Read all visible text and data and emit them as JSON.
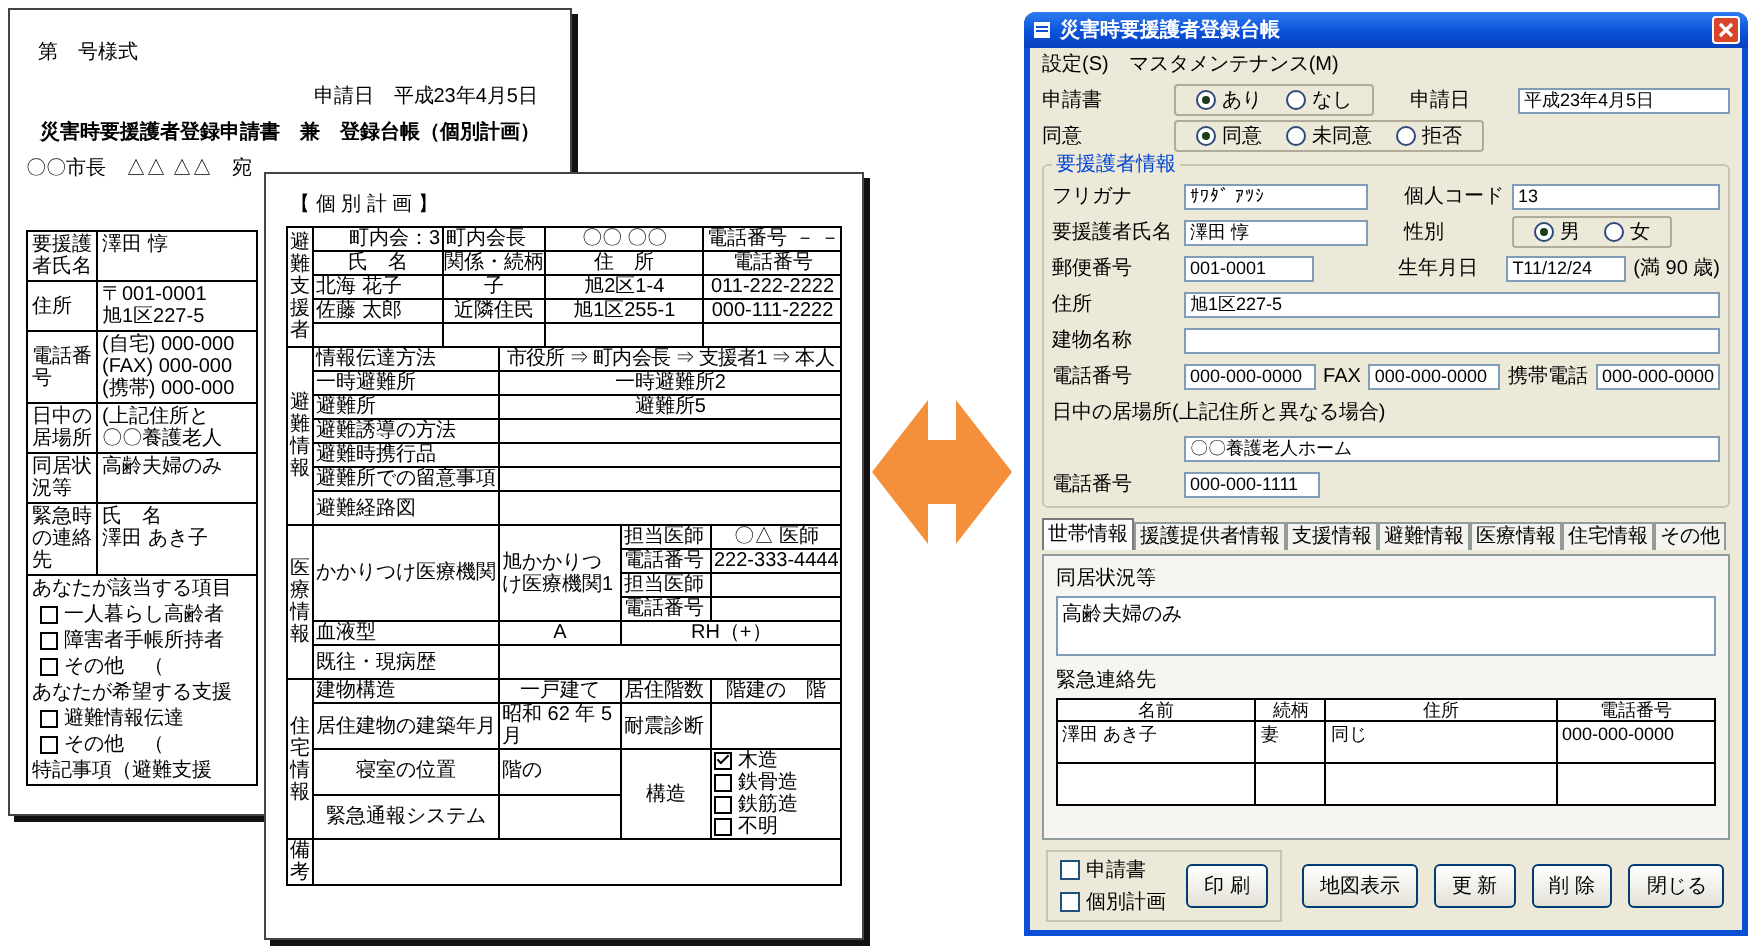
{
  "application_form": {
    "form_number": "第　号様式",
    "date": "申請日　平成23年4月5日",
    "title": "災害時要援護者登録申請書　兼　登録台帳（個別計画）",
    "addressee": "〇〇市長　△△ △△　宛",
    "rows": [
      {
        "label": "要援護者氏名",
        "lines": [
          "澤田 惇"
        ]
      },
      {
        "label": "住所",
        "lines": [
          "〒001-0001",
          "旭1区227-5"
        ]
      },
      {
        "label": "電話番号",
        "lines": [
          "(自宅) 000-000",
          "(FAX) 000-000",
          "(携帯) 000-000"
        ]
      },
      {
        "label": "日中の居場所",
        "lines": [
          "(上記住所と",
          "〇〇養護老人"
        ]
      },
      {
        "label": "同居状況等",
        "lines": [
          "高齢夫婦のみ"
        ]
      },
      {
        "label": "緊急時の連絡先",
        "lines": [
          "氏　名",
          "澤田 あき子"
        ]
      }
    ],
    "checklist": [
      {
        "kind": "note",
        "text": "あなたが該当する項目"
      },
      {
        "kind": "check",
        "text": "一人暮らし高齢者",
        "checked": false
      },
      {
        "kind": "check",
        "text": "障害者手帳所持者",
        "checked": false
      },
      {
        "kind": "check",
        "text": "その他　（",
        "checked": false
      },
      {
        "kind": "note",
        "text": "あなたが希望する支援"
      },
      {
        "kind": "check",
        "text": "避難情報伝達",
        "checked": false
      },
      {
        "kind": "check",
        "text": "その他　（",
        "checked": false
      },
      {
        "kind": "note",
        "text": "特記事項（避難支援"
      }
    ]
  },
  "individual_plan": {
    "heading": "【 個 別 計 画 】",
    "supporters": {
      "section": "避難支援者",
      "neighborhood": "町内会：3",
      "chief_label": "町内会長",
      "chief_name": "〇〇 〇〇",
      "phone_label": "電話番号",
      "phone_value": "－ －",
      "columns": [
        "氏　名",
        "関係・続柄",
        "住　所",
        "電話番号"
      ],
      "rows": [
        [
          "北海 花子",
          "子",
          "旭2区1-4",
          "011-222-2222"
        ],
        [
          "佐藤 太郎",
          "近隣住民",
          "旭1区255-1",
          "000-111-2222"
        ]
      ]
    },
    "evacuation": {
      "section": "避難情報",
      "rows": [
        {
          "label": "情報伝達方法",
          "value": "市役所 ⇒ 町内会長 ⇒ 支援者1 ⇒ 本人"
        },
        {
          "label": "一時避難所",
          "value": "一時避難所2"
        },
        {
          "label": "避難所",
          "value": "避難所5"
        },
        {
          "label": "避難誘導の方法"
        },
        {
          "label": "避難時携行品"
        },
        {
          "label": "避難所での留意事項"
        },
        {
          "label": "避難経路図"
        }
      ]
    },
    "medical": {
      "section": "医療情報",
      "clinic_label": "かかりつけ医療機関",
      "clinic": "旭かかりつけ医療機関1",
      "doctors": [
        {
          "label": "担当医師",
          "value": "〇△ 医師"
        },
        {
          "label": "電話番号",
          "value": "222-333-4444"
        },
        {
          "label": "担当医師"
        },
        {
          "label": "電話番号"
        }
      ],
      "blood_label": "血液型",
      "blood_abo": "A",
      "blood_rh": "RH（+）",
      "history_label": "既往・現病歴"
    },
    "housing": {
      "section": "住宅情報",
      "building_label": "建物構造",
      "building": "一戸建て",
      "floors_label": "居住階数",
      "floors": "階建の　階",
      "built_label": "居住建物の建築年月",
      "built": "昭和 62 年 5 月",
      "seismic_label": "耐震診断",
      "bedroom_label": "寝室の位置",
      "bedroom": "階の",
      "structure_label": "構造",
      "structures": [
        {
          "label": "木造",
          "checked": true
        },
        {
          "label": "鉄骨造",
          "checked": false
        },
        {
          "label": "鉄筋造",
          "checked": false
        },
        {
          "label": "不明",
          "checked": false
        }
      ],
      "alarm_label": "緊急通報システム"
    },
    "remarks": {
      "section": "備考"
    }
  },
  "app_window": {
    "title": "災害時要援護者登録台帳",
    "menu": [
      "設定(S)",
      "マスタメンテナンス(M)"
    ],
    "application": {
      "label": "申請書",
      "options": [
        {
          "label": "あり",
          "selected": true
        },
        {
          "label": "なし",
          "selected": false
        }
      ],
      "date_label": "申請日",
      "date_value": "平成23年4月5日"
    },
    "consent": {
      "label": "同意",
      "options": [
        {
          "label": "同意",
          "selected": true
        },
        {
          "label": "未同意",
          "selected": false
        },
        {
          "label": "拒否",
          "selected": false
        }
      ]
    },
    "person": {
      "legend": "要援護者情報",
      "furigana_label": "フリガナ",
      "furigana": "ｻﾜﾀﾞ ｱﾂｼ",
      "code_label": "個人コード",
      "code": "13",
      "name_label": "要援護者氏名",
      "name": "澤田 惇",
      "sex_label": "性別",
      "sex_options": [
        {
          "label": "男",
          "selected": true
        },
        {
          "label": "女",
          "selected": false
        }
      ],
      "postal_label": "郵便番号",
      "postal": "001-0001",
      "birth_label": "生年月日",
      "birth": "T11/12/24",
      "age": "(満 90 歳)",
      "address_label": "住所",
      "address": "旭1区227-5",
      "building_label": "建物名称",
      "phone_label": "電話番号",
      "phone": "000-000-0000",
      "fax_label": "FAX",
      "fax": "000-000-0000",
      "mobile_label": "携帯電話",
      "mobile": "000-000-0000",
      "daytime_label": "日中の居場所(上記住所と異なる場合)",
      "daytime": "〇〇養護老人ホーム",
      "daytime_phone_label": "電話番号",
      "daytime_phone": "000-000-1111"
    },
    "tabs": [
      {
        "label": "世帯情報",
        "selected": true
      },
      {
        "label": "援護提供者情報",
        "selected": false
      },
      {
        "label": "支援情報",
        "selected": false
      },
      {
        "label": "避難情報",
        "selected": false
      },
      {
        "label": "医療情報",
        "selected": false
      },
      {
        "label": "住宅情報",
        "selected": false
      },
      {
        "label": "その他",
        "selected": false
      }
    ],
    "household_label": "同居状況等",
    "household": "高齢夫婦のみ",
    "contacts": {
      "label": "緊急連絡先",
      "columns": [
        "名前",
        "続柄",
        "住所",
        "電話番号"
      ],
      "rows": [
        [
          "澤田 あき子",
          "妻",
          "同じ",
          "000-000-0000"
        ]
      ]
    },
    "print_options": [
      {
        "label": "申請書",
        "checked": false
      },
      {
        "label": "個別計画",
        "checked": false
      }
    ],
    "buttons": [
      "印 刷",
      "地図表示",
      "更 新",
      "削 除",
      "閉じる"
    ]
  }
}
